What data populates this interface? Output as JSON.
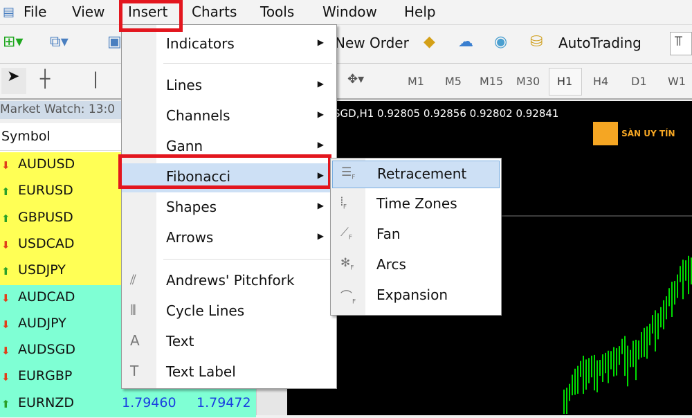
{
  "menubar": {
    "items": [
      "File",
      "View",
      "Insert",
      "Charts",
      "Tools",
      "Window",
      "Help"
    ]
  },
  "toolbar": {
    "new_order": "New Order",
    "autotrading": "AutoTrading",
    "timeframes": [
      "M1",
      "M5",
      "M15",
      "M30",
      "H1",
      "H4",
      "D1",
      "W1"
    ],
    "active_timeframe": "H1"
  },
  "market_watch": {
    "title": "Market Watch: 13:0",
    "symbol_header": "Symbol",
    "rows": [
      {
        "symbol": "AUDUSD",
        "dir": "down",
        "bid": "",
        "ask": ""
      },
      {
        "symbol": "EURUSD",
        "dir": "up",
        "bid": "",
        "ask": ""
      },
      {
        "symbol": "GBPUSD",
        "dir": "up",
        "bid": "",
        "ask": ""
      },
      {
        "symbol": "USDCAD",
        "dir": "down",
        "bid": "",
        "ask": ""
      },
      {
        "symbol": "USDJPY",
        "dir": "up",
        "bid": "",
        "ask": ""
      },
      {
        "symbol": "AUDCAD",
        "dir": "down",
        "bid": "",
        "ask": ""
      },
      {
        "symbol": "AUDJPY",
        "dir": "down",
        "bid": "",
        "ask": ""
      },
      {
        "symbol": "AUDSGD",
        "dir": "down",
        "bid": "",
        "ask": ""
      },
      {
        "symbol": "EURGBP",
        "dir": "down",
        "bid": "",
        "ask": ""
      },
      {
        "symbol": "EURNZD",
        "dir": "up",
        "bid": "1.79460",
        "ask": "1.79472"
      }
    ],
    "colors": {
      "major": "#ffff55",
      "cross": "#7fffd4",
      "up": "#2aa02a",
      "down": "#e0401a"
    }
  },
  "chart": {
    "info": "SGD,H1  0.92805 0.92856 0.92802 0.92841",
    "bar_color": "#00dd00"
  },
  "insert_menu": {
    "items": [
      {
        "label": "Indicators",
        "sub": true,
        "icon": ""
      },
      {
        "label": "Lines",
        "sub": true,
        "icon": ""
      },
      {
        "label": "Channels",
        "sub": true,
        "icon": ""
      },
      {
        "label": "Gann",
        "sub": true,
        "icon": ""
      },
      {
        "label": "Fibonacci",
        "sub": true,
        "icon": ""
      },
      {
        "label": "Shapes",
        "sub": true,
        "icon": ""
      },
      {
        "label": "Arrows",
        "sub": true,
        "icon": ""
      },
      {
        "label": "Andrews' Pitchfork",
        "sub": false,
        "icon": "pitchfork-icon"
      },
      {
        "label": "Cycle Lines",
        "sub": false,
        "icon": "cycle-lines-icon"
      },
      {
        "label": "Text",
        "sub": false,
        "icon": "text-icon"
      },
      {
        "label": "Text Label",
        "sub": false,
        "icon": "text-label-icon"
      }
    ],
    "highlighted": "Fibonacci"
  },
  "fibonacci_submenu": {
    "items": [
      "Retracement",
      "Time Zones",
      "Fan",
      "Arcs",
      "Expansion"
    ],
    "highlighted": "Retracement"
  },
  "watermark": "SÀN UY TÍN"
}
